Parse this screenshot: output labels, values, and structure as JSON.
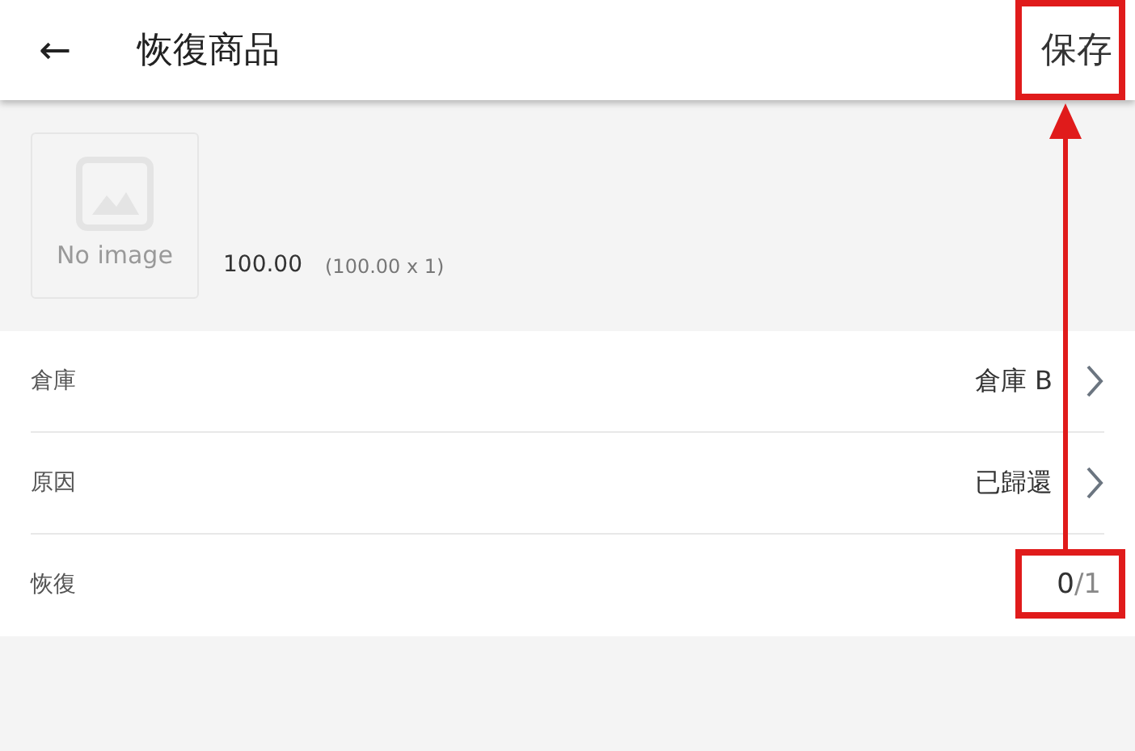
{
  "header": {
    "back": "←",
    "title": "恢復商品",
    "save": "保存"
  },
  "product": {
    "image": {
      "kind": "placeholder",
      "label": "No image"
    },
    "price": "100.00",
    "detail": "(100.00 x 1)"
  },
  "rows": [
    {
      "kind": "select",
      "label": "倉庫",
      "value": "倉庫 B"
    },
    {
      "kind": "select",
      "label": "原因",
      "value": "已歸還"
    },
    {
      "kind": "quantity",
      "label": "恢復",
      "value": "0",
      "total": "/1"
    }
  ],
  "annotations": [
    {
      "kind": "headerbox"
    },
    {
      "kind": "rowbox"
    },
    {
      "kind": "arrow"
    }
  ]
}
